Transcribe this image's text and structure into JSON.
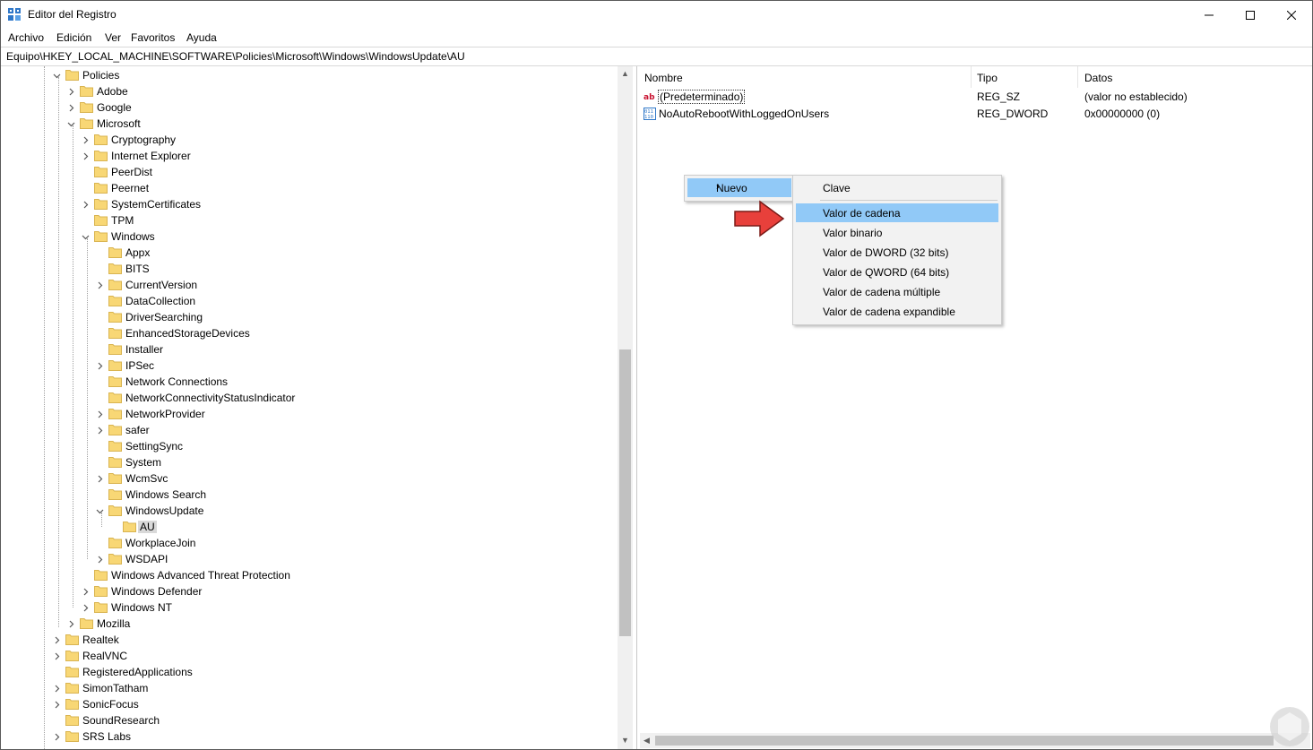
{
  "window": {
    "title": "Editor del Registro",
    "controls": {
      "minimize": "–",
      "maximize": "☐",
      "close": "✕"
    }
  },
  "menu": [
    "Archivo",
    "Edición",
    "Ver",
    "Favoritos",
    "Ayuda"
  ],
  "address": "Equipo\\HKEY_LOCAL_MACHINE\\SOFTWARE\\Policies\\Microsoft\\Windows\\WindowsUpdate\\AU",
  "tree": [
    {
      "label": "Policies",
      "level": 3,
      "expander": "down"
    },
    {
      "label": "Adobe",
      "level": 4,
      "expander": "right"
    },
    {
      "label": "Google",
      "level": 4,
      "expander": "right"
    },
    {
      "label": "Microsoft",
      "level": 4,
      "expander": "down"
    },
    {
      "label": "Cryptography",
      "level": 5,
      "expander": "right"
    },
    {
      "label": "Internet Explorer",
      "level": 5,
      "expander": "right"
    },
    {
      "label": "PeerDist",
      "level": 5,
      "expander": ""
    },
    {
      "label": "Peernet",
      "level": 5,
      "expander": ""
    },
    {
      "label": "SystemCertificates",
      "level": 5,
      "expander": "right"
    },
    {
      "label": "TPM",
      "level": 5,
      "expander": ""
    },
    {
      "label": "Windows",
      "level": 5,
      "expander": "down"
    },
    {
      "label": "Appx",
      "level": 6,
      "expander": ""
    },
    {
      "label": "BITS",
      "level": 6,
      "expander": ""
    },
    {
      "label": "CurrentVersion",
      "level": 6,
      "expander": "right"
    },
    {
      "label": "DataCollection",
      "level": 6,
      "expander": ""
    },
    {
      "label": "DriverSearching",
      "level": 6,
      "expander": ""
    },
    {
      "label": "EnhancedStorageDevices",
      "level": 6,
      "expander": ""
    },
    {
      "label": "Installer",
      "level": 6,
      "expander": ""
    },
    {
      "label": "IPSec",
      "level": 6,
      "expander": "right"
    },
    {
      "label": "Network Connections",
      "level": 6,
      "expander": ""
    },
    {
      "label": "NetworkConnectivityStatusIndicator",
      "level": 6,
      "expander": ""
    },
    {
      "label": "NetworkProvider",
      "level": 6,
      "expander": "right"
    },
    {
      "label": "safer",
      "level": 6,
      "expander": "right"
    },
    {
      "label": "SettingSync",
      "level": 6,
      "expander": ""
    },
    {
      "label": "System",
      "level": 6,
      "expander": ""
    },
    {
      "label": "WcmSvc",
      "level": 6,
      "expander": "right"
    },
    {
      "label": "Windows Search",
      "level": 6,
      "expander": ""
    },
    {
      "label": "WindowsUpdate",
      "level": 6,
      "expander": "down"
    },
    {
      "label": "AU",
      "level": 7,
      "expander": "",
      "selected": true
    },
    {
      "label": "WorkplaceJoin",
      "level": 6,
      "expander": ""
    },
    {
      "label": "WSDAPI",
      "level": 6,
      "expander": "right"
    },
    {
      "label": "Windows Advanced Threat Protection",
      "level": 5,
      "expander": ""
    },
    {
      "label": "Windows Defender",
      "level": 5,
      "expander": "right"
    },
    {
      "label": "Windows NT",
      "level": 5,
      "expander": "right"
    },
    {
      "label": "Mozilla",
      "level": 4,
      "expander": "right"
    },
    {
      "label": "Realtek",
      "level": 3,
      "expander": "right"
    },
    {
      "label": "RealVNC",
      "level": 3,
      "expander": "right"
    },
    {
      "label": "RegisteredApplications",
      "level": 3,
      "expander": ""
    },
    {
      "label": "SimonTatham",
      "level": 3,
      "expander": "right"
    },
    {
      "label": "SonicFocus",
      "level": 3,
      "expander": "right"
    },
    {
      "label": "SoundResearch",
      "level": 3,
      "expander": ""
    },
    {
      "label": "SRS Labs",
      "level": 3,
      "expander": "right"
    }
  ],
  "columns": {
    "name": "Nombre",
    "type": "Tipo",
    "data": "Datos"
  },
  "values": [
    {
      "name": "(Predeterminado)",
      "type": "REG_SZ",
      "data": "(valor no establecido)",
      "icon": "string-value-icon"
    },
    {
      "name": "NoAutoRebootWithLoggedOnUsers",
      "type": "REG_DWORD",
      "data": "0x00000000 (0)",
      "icon": "dword-value-icon"
    }
  ],
  "context_menu": {
    "parent": "Nuevo",
    "submenu": [
      "Clave",
      "Valor de cadena",
      "Valor binario",
      "Valor de DWORD (32 bits)",
      "Valor de QWORD (64 bits)",
      "Valor de cadena múltiple",
      "Valor de cadena expandible"
    ],
    "highlighted": "Valor de cadena"
  },
  "colors": {
    "highlight": "#91c9f7",
    "folder": "#f8d775",
    "arrow": "#e8403b"
  }
}
